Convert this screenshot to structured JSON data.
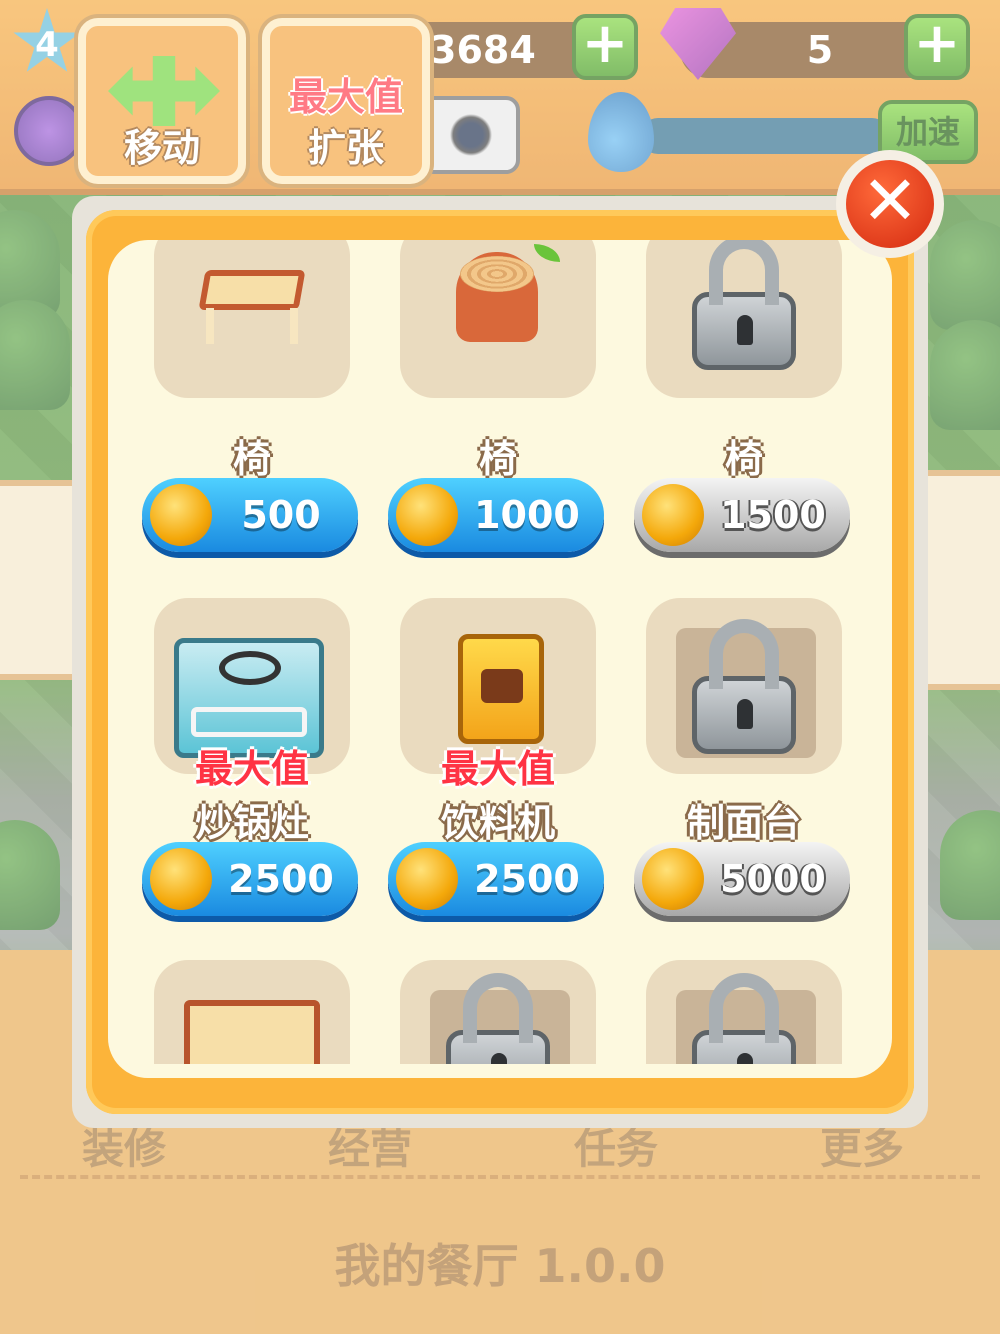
{
  "hud": {
    "level": "4",
    "coins": "3684",
    "gems": "5",
    "plus_symbol": "+",
    "speed_label": "加速"
  },
  "actions": {
    "move_label": "移动",
    "expand_label": "扩张",
    "expand_tag": "最大值"
  },
  "modal": {
    "close_symbol": "✕",
    "items": [
      {
        "name": "椅",
        "price": "500",
        "locked": false,
        "max": false,
        "art": "table-icon"
      },
      {
        "name": "椅",
        "price": "1000",
        "locked": false,
        "max": false,
        "art": "stump-stool-icon"
      },
      {
        "name": "椅",
        "price": "1500",
        "locked": true,
        "max": false,
        "art": "lock-icon"
      },
      {
        "name": "炒锅灶",
        "price": "2500",
        "locked": false,
        "max": true,
        "max_label": "最大值",
        "art": "stove-icon"
      },
      {
        "name": "饮料机",
        "price": "2500",
        "locked": false,
        "max": true,
        "max_label": "最大值",
        "art": "drink-machine-icon"
      },
      {
        "name": "制面台",
        "price": "5000",
        "locked": true,
        "max": false,
        "art": "lock-icon"
      },
      {
        "name": "",
        "price": "",
        "locked": false,
        "max": false,
        "art": "shelf-icon"
      },
      {
        "name": "",
        "price": "",
        "locked": true,
        "max": false,
        "art": "lock-icon"
      },
      {
        "name": "",
        "price": "",
        "locked": true,
        "max": false,
        "art": "lock-icon"
      }
    ]
  },
  "bottom_nav": {
    "items": [
      "装修",
      "经营",
      "任务",
      "更多"
    ],
    "version": "我的餐厅 1.0.0"
  },
  "colors": {
    "buy_button": "#1a8ae0",
    "locked_button": "#a8a8a8",
    "max_label": "#ff3344"
  }
}
